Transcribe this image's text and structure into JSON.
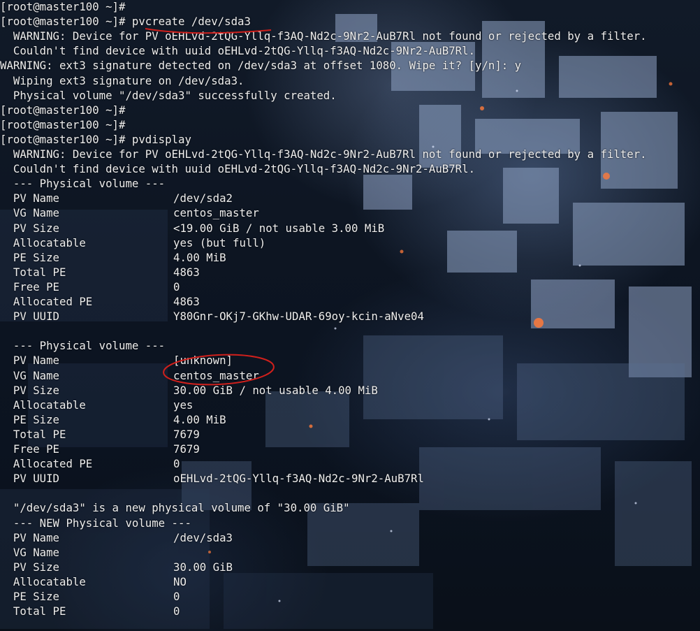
{
  "colors": {
    "text": "#eeeeee",
    "annotation": "#d0201c",
    "background": "#0c1320"
  },
  "terminal": {
    "lines": [
      {
        "text": "[root@master100 ~]#"
      },
      {
        "text": "[root@master100 ~]# pvcreate /dev/sda3"
      },
      {
        "text": "  WARNING: Device for PV oEHLvd-2tQG-Yllq-f3AQ-Nd2c-9Nr2-AuB7Rl not found or rejected by a filter."
      },
      {
        "text": "  Couldn't find device with uuid oEHLvd-2tQG-Yllq-f3AQ-Nd2c-9Nr2-AuB7Rl."
      },
      {
        "text": "WARNING: ext3 signature detected on /dev/sda3 at offset 1080. Wipe it? [y/n]: y"
      },
      {
        "text": "  Wiping ext3 signature on /dev/sda3."
      },
      {
        "text": "  Physical volume \"/dev/sda3\" successfully created."
      },
      {
        "text": "[root@master100 ~]#"
      },
      {
        "text": "[root@master100 ~]#"
      },
      {
        "text": "[root@master100 ~]# pvdisplay"
      },
      {
        "text": "  WARNING: Device for PV oEHLvd-2tQG-Yllq-f3AQ-Nd2c-9Nr2-AuB7Rl not found or rejected by a filter."
      },
      {
        "text": "  Couldn't find device with uuid oEHLvd-2tQG-Yllq-f3AQ-Nd2c-9Nr2-AuB7Rl."
      },
      {
        "text": "  --- Physical volume ---"
      },
      {
        "key": "  PV Name",
        "value": "/dev/sda2"
      },
      {
        "key": "  VG Name",
        "value": "centos_master"
      },
      {
        "key": "  PV Size",
        "value": "<19.00 GiB / not usable 3.00 MiB"
      },
      {
        "key": "  Allocatable",
        "value": "yes (but full)"
      },
      {
        "key": "  PE Size",
        "value": "4.00 MiB"
      },
      {
        "key": "  Total PE",
        "value": "4863"
      },
      {
        "key": "  Free PE",
        "value": "0"
      },
      {
        "key": "  Allocated PE",
        "value": "4863"
      },
      {
        "key": "  PV UUID",
        "value": "Y80Gnr-OKj7-GKhw-UDAR-69oy-kcin-aNve04"
      },
      {
        "text": ""
      },
      {
        "text": "  --- Physical volume ---"
      },
      {
        "key": "  PV Name",
        "value": "[unknown]"
      },
      {
        "key": "  VG Name",
        "value": "centos_master"
      },
      {
        "key": "  PV Size",
        "value": "30.00 GiB / not usable 4.00 MiB"
      },
      {
        "key": "  Allocatable",
        "value": "yes"
      },
      {
        "key": "  PE Size",
        "value": "4.00 MiB"
      },
      {
        "key": "  Total PE",
        "value": "7679"
      },
      {
        "key": "  Free PE",
        "value": "7679"
      },
      {
        "key": "  Allocated PE",
        "value": "0"
      },
      {
        "key": "  PV UUID",
        "value": "oEHLvd-2tQG-Yllq-f3AQ-Nd2c-9Nr2-AuB7Rl"
      },
      {
        "text": ""
      },
      {
        "text": "  \"/dev/sda3\" is a new physical volume of \"30.00 GiB\""
      },
      {
        "text": "  --- NEW Physical volume ---"
      },
      {
        "key": "  PV Name",
        "value": "/dev/sda3"
      },
      {
        "key": "  VG Name",
        "value": ""
      },
      {
        "key": "  PV Size",
        "value": "30.00 GiB"
      },
      {
        "key": "  Allocatable",
        "value": "NO"
      },
      {
        "key": "  PE Size",
        "value": "0"
      },
      {
        "key": "  Total PE",
        "value": "0"
      }
    ]
  }
}
